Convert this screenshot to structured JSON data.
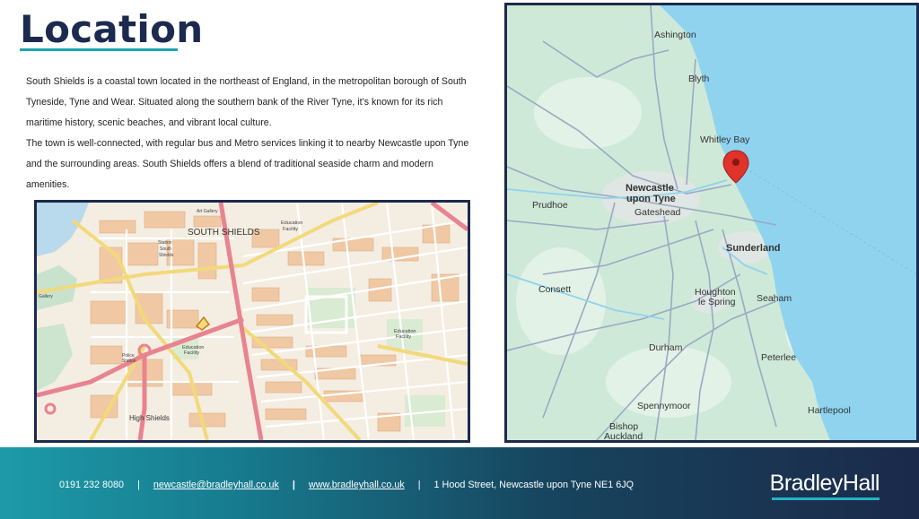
{
  "header": {
    "title": "Location"
  },
  "intro": {
    "paragraph1": "South Shields is a coastal town located in the northeast of England, in the metropolitan borough of South Tyneside, Tyne and Wear. Situated along the southern bank of the River Tyne, it’s known for its rich maritime history, scenic beaches, and vibrant local culture.",
    "paragraph2": "The town is well-connected, with regular bus and Metro services linking it to nearby Newcastle upon Tyne and the surrounding areas. South Shields offers a blend of traditional seaside charm and modern amenities."
  },
  "street_map": {
    "labels": {
      "town": "SOUTH SHIELDS",
      "high_shields": "High Shields",
      "edu1": "Education",
      "edu1b": "Facility",
      "edu2": "Education",
      "edu2b": "Facility",
      "edu3": "Education",
      "edu3b": "Facility",
      "police": "Police",
      "police_b": "Station",
      "station": "Station",
      "south": "South",
      "shields": "Shields",
      "art_gallery": "Art Gallery",
      "gallery": "Gallery"
    }
  },
  "region_map": {
    "places": {
      "ashington": "Ashington",
      "blyth": "Blyth",
      "whitley_bay": "Whitley Bay",
      "newcastle1": "Newcastle",
      "newcastle2": "upon Tyne",
      "prudhoe": "Prudhoe",
      "gateshead": "Gateshead",
      "sunderland": "Sunderland",
      "consett": "Consett",
      "houghton1": "Houghton",
      "houghton2": "le Spring",
      "seaham": "Seaham",
      "durham": "Durham",
      "peterlee": "Peterlee",
      "spennymoor": "Spennymoor",
      "hartlepool": "Hartlepool",
      "bishop1": "Bishop",
      "bishop2": "Auckland"
    },
    "colors": {
      "sea": "#8fd3ef",
      "land": "#cfe9d8",
      "pin": "#e0332b"
    }
  },
  "footer": {
    "phone": "0191 232 8080",
    "email": "newcastle@bradleyhall.co.uk",
    "website": "www.bradleyhall.co.uk",
    "address": "1 Hood Street, Newcastle upon Tyne NE1 6JQ",
    "sep1": "|",
    "sep2": "|",
    "sep3": "|",
    "brand": "BradleyHall"
  }
}
